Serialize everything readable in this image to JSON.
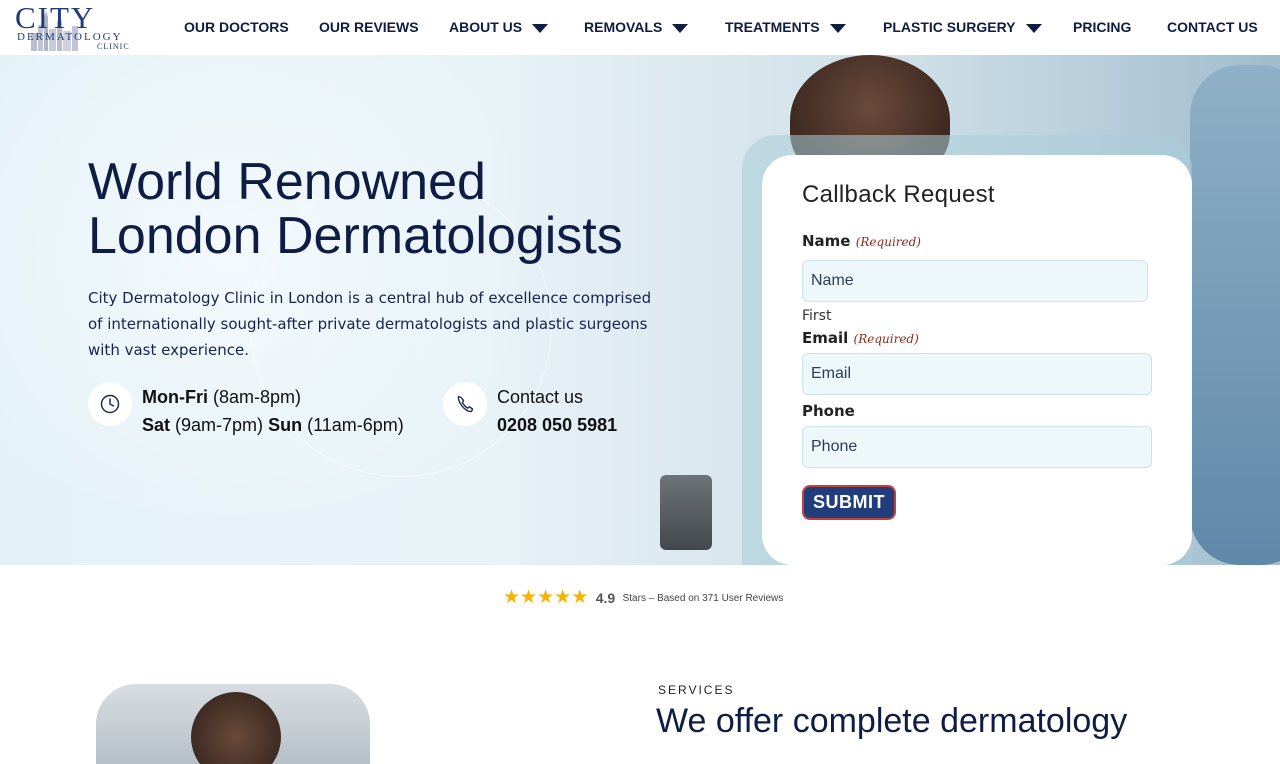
{
  "logo": {
    "city": "CITY",
    "dermatology": "DERMATOLOGY",
    "clinic": "CLINIC"
  },
  "nav": {
    "our_doctors": "OUR DOCTORS",
    "our_reviews": "OUR REVIEWS",
    "about_us": "ABOUT US",
    "removals": "REMOVALS",
    "treatments": "TREATMENTS",
    "plastic_surgery": "PLASTIC SURGERY",
    "pricing": "PRICING",
    "contact_us": "CONTACT US"
  },
  "hero": {
    "title_line1": "World Renowned",
    "title_line2": "London Dermatologists",
    "description": "City Dermatology Clinic in London is a central hub of excellence comprised of internationally sought-after private dermatologists and plastic surgeons with vast experience.",
    "hours": {
      "monfri_label": "Mon-Fri",
      "monfri_time": "(8am-8pm)",
      "sat_label": "Sat",
      "sat_time": "(9am-7pm)",
      "sun_label": "Sun",
      "sun_time": "(11am-6pm)"
    },
    "contact": {
      "label": "Contact us",
      "phone": "0208 050 5981"
    }
  },
  "form": {
    "title": "Callback Request",
    "name_label": "Name",
    "name_required": "(Required)",
    "name_placeholder": "Name",
    "name_sublabel": "First",
    "email_label": "Email",
    "email_required": "(Required)",
    "email_placeholder": "Email",
    "phone_label": "Phone",
    "phone_placeholder": "Phone",
    "submit": "SUBMIT"
  },
  "rating": {
    "score": "4.9",
    "text": "Stars – Based on 371 User Reviews",
    "star_count": 5
  },
  "services": {
    "eyebrow": "SERVICES",
    "heading": "We offer complete dermatology"
  },
  "colors": {
    "navy": "#0f1d44",
    "button": "#213d7c",
    "star": "#f5b400",
    "required": "#8a2a1e"
  }
}
